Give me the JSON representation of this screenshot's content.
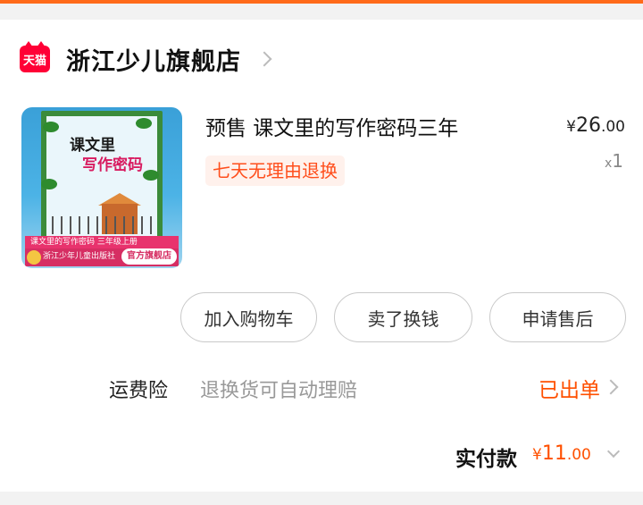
{
  "store": {
    "badge_text": "天猫",
    "name": "浙江少儿旗舰店",
    "icon": "tmall-icon",
    "chevron_icon": "chevron-right-icon"
  },
  "product": {
    "title": "预售 课文里的写作密码三年",
    "tag": "七天无理由退换",
    "price_symbol": "¥",
    "price_int": "26",
    "price_dec": ".00",
    "qty_prefix": "x",
    "qty": "1",
    "image": {
      "title_line1": "课文里",
      "title_line2": "写作密码",
      "strip_text": "课文里的写作密码 三年级上册",
      "publisher": "浙江少年儿童出版社",
      "official_badge": "官方旗舰店"
    }
  },
  "actions": {
    "add_to_cart": "加入购物车",
    "sell_for_cash": "卖了换钱",
    "after_sales": "申请售后"
  },
  "insurance": {
    "label": "运费险",
    "desc": "退换货可自动理赔",
    "status": "已出单"
  },
  "payment": {
    "label": "实付款",
    "symbol": "¥",
    "amount_int": "11",
    "amount_dec": ".00"
  },
  "colors": {
    "accent": "#ff5000",
    "tmall_red": "#ff0036",
    "tag_bg": "#fff1ec"
  }
}
